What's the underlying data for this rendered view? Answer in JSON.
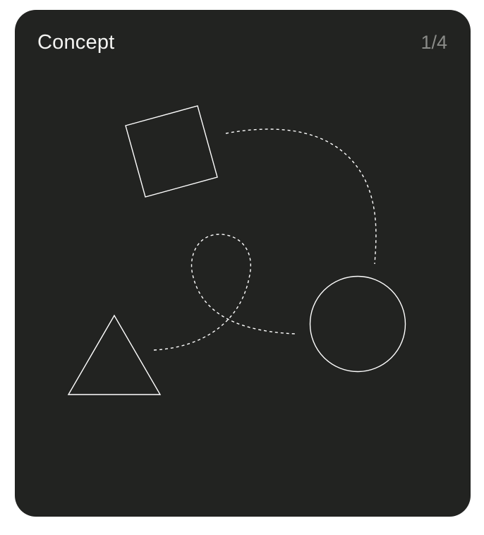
{
  "card": {
    "title": "Concept",
    "counter": "1/4"
  },
  "colors": {
    "card_background": "#222321",
    "page_background": "#ffffff",
    "title_text": "#f4f4f2",
    "counter_text": "#8a8b88",
    "stroke": "#ffffff"
  },
  "illustration": {
    "shapes": [
      "square-icon",
      "triangle-icon",
      "circle-icon"
    ],
    "connectors": [
      "dashed-arc-connector",
      "dashed-loop-connector"
    ]
  }
}
